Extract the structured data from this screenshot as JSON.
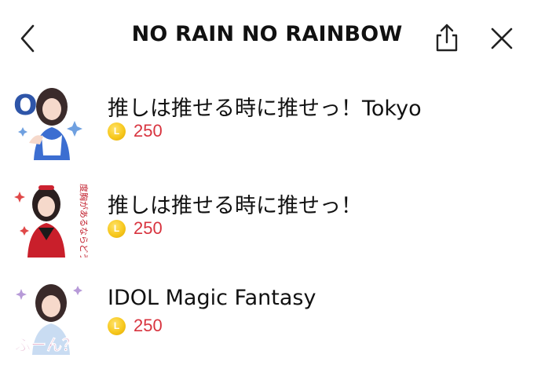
{
  "header": {
    "title": "NO RAIN NO RAINBOW",
    "back_icon": "chevron-left-icon",
    "share_icon": "share-icon",
    "close_icon": "close-icon"
  },
  "items": [
    {
      "title": "推しは推せる時に推せっ！Tokyo",
      "price": "250",
      "thumb_text": "OK"
    },
    {
      "title": "推しは推せる時に推せっ！",
      "price": "250",
      "thumb_text": "度胸があるならどうぞ"
    },
    {
      "title": "IDOL Magic Fantasy",
      "price": "250",
      "thumb_text": "ふーん？"
    }
  ],
  "coin_symbol": "L",
  "colors": {
    "price": "#d8343f",
    "coin": "#f7c81e",
    "text": "#111111",
    "background": "#ffffff"
  }
}
